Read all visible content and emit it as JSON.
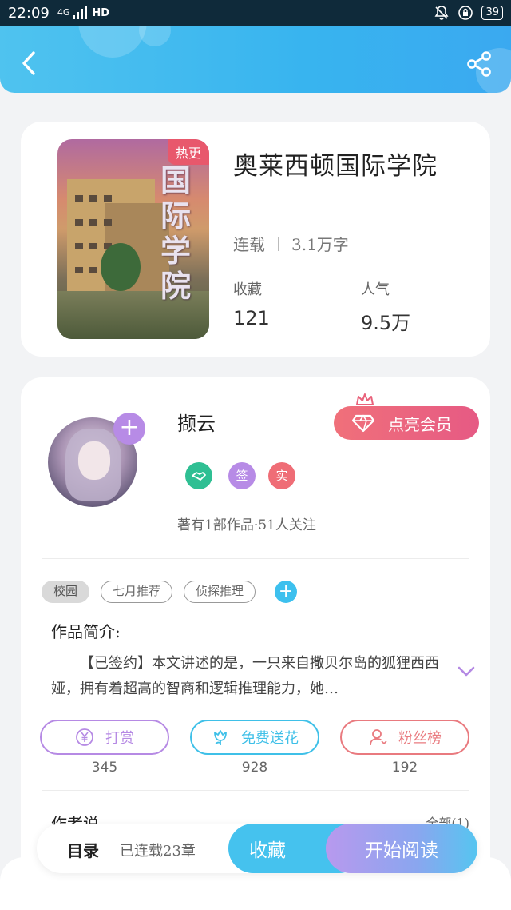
{
  "status_bar": {
    "time": "22:09",
    "network": "4G",
    "hd": "HD",
    "battery": "39"
  },
  "header": {
    "back_icon": "chevron-left-icon",
    "share_icon": "share-icon"
  },
  "book": {
    "hot_tag": "热更",
    "cover_title": "国际学院",
    "title": "奥莱西顿国际学院",
    "status": "连载",
    "word_count": "3.1万字",
    "favorites_label": "收藏",
    "favorites_value": "121",
    "popularity_label": "人气",
    "popularity_value": "9.5万"
  },
  "author": {
    "name": "撷云",
    "follow_icon": "plus-icon",
    "vip_label": "点亮会员",
    "badges": [
      "签",
      "实"
    ],
    "stats": "著有1部作品·51人关注"
  },
  "tags": [
    "校园",
    "七月推荐",
    "侦探推理"
  ],
  "intro": {
    "title": "作品简介:",
    "text": "【已签约】本文讲述的是，一只来自撒贝尔岛的狐狸西西娅，拥有着超高的智商和逻辑推理能力，她…"
  },
  "actions": [
    {
      "label": "打赏",
      "count": "345",
      "color": "#b68ae4"
    },
    {
      "label": "免费送花",
      "count": "928",
      "color": "#3fc0e8"
    },
    {
      "label": "粉丝榜",
      "count": "192",
      "color": "#e97a7f"
    }
  ],
  "author_said": {
    "title": "作者说",
    "all": "全部(1)"
  },
  "bottom": {
    "toc_label": "目录",
    "toc_count": "已连载23章",
    "favorite_button": "收藏",
    "read_button": "开始阅读"
  }
}
